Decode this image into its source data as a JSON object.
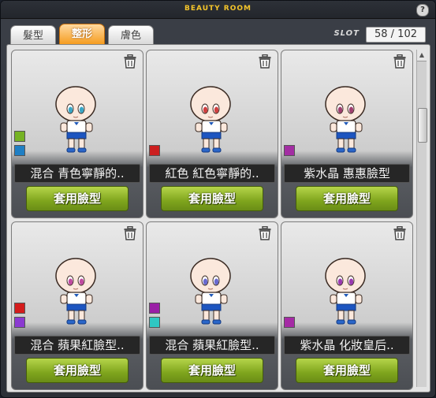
{
  "window": {
    "title": "BEAUTY ROOM",
    "help_label": "?"
  },
  "tabs": [
    {
      "label": "髮型",
      "active": false
    },
    {
      "label": "整形",
      "active": true
    },
    {
      "label": "膚色",
      "active": false
    }
  ],
  "slot": {
    "label": "SLOT",
    "value": "58 / 102"
  },
  "apply_label": "套用臉型",
  "cards": [
    {
      "name": "混合  青色寧靜的..",
      "swatches": [
        "#76b324",
        "#1f7fc4"
      ],
      "eye_color": "#3aa6c6"
    },
    {
      "name": "紅色  紅色寧靜的..",
      "swatches": [
        "#cc1f1f"
      ],
      "eye_color": "#d04040"
    },
    {
      "name": "紫水晶  惠惠臉型",
      "swatches": [
        "#a32ea3"
      ],
      "eye_color": "#a04070"
    },
    {
      "name": "混合  蘋果紅臉型..",
      "swatches": [
        "#d41c1c",
        "#8b3ad1"
      ],
      "eye_color": "#c04aa0"
    },
    {
      "name": "混合  蘋果紅臉型..",
      "swatches": [
        "#9a1fa6",
        "#2fc7c2"
      ],
      "eye_color": "#6a6ad0"
    },
    {
      "name": "紫水晶  化妝皇后..",
      "swatches": [
        "#a52aa5"
      ],
      "eye_color": "#9a3ab0"
    }
  ]
}
